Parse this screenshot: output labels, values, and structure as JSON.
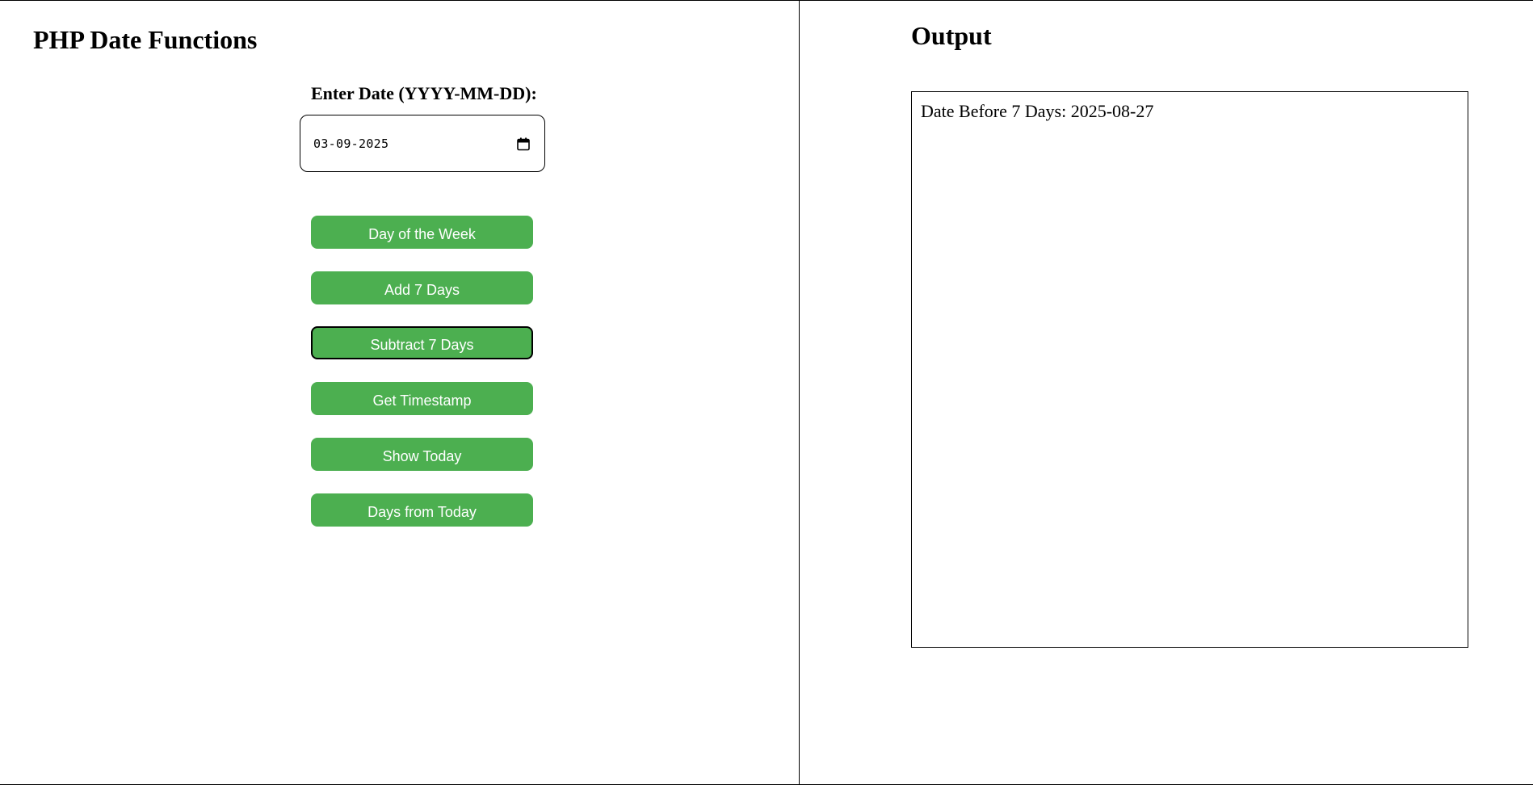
{
  "form": {
    "title": "PHP Date Functions",
    "date_label": "Enter Date (YYYY-MM-DD):",
    "date_value": "03-09-2025"
  },
  "buttons": {
    "day_of_week": "Day of the Week",
    "add_7_days": "Add 7 Days",
    "subtract_7_days": "Subtract 7 Days",
    "get_timestamp": "Get Timestamp",
    "show_today": "Show Today",
    "days_from_today": "Days from Today"
  },
  "output": {
    "title": "Output",
    "result": "Date Before 7 Days: 2025-08-27"
  },
  "colors": {
    "button_background": "#4caf50",
    "button_text": "#ffffff"
  },
  "icons": {
    "date_picker": "calendar-icon"
  },
  "state": {
    "focused_button": "subtract_7_days"
  }
}
